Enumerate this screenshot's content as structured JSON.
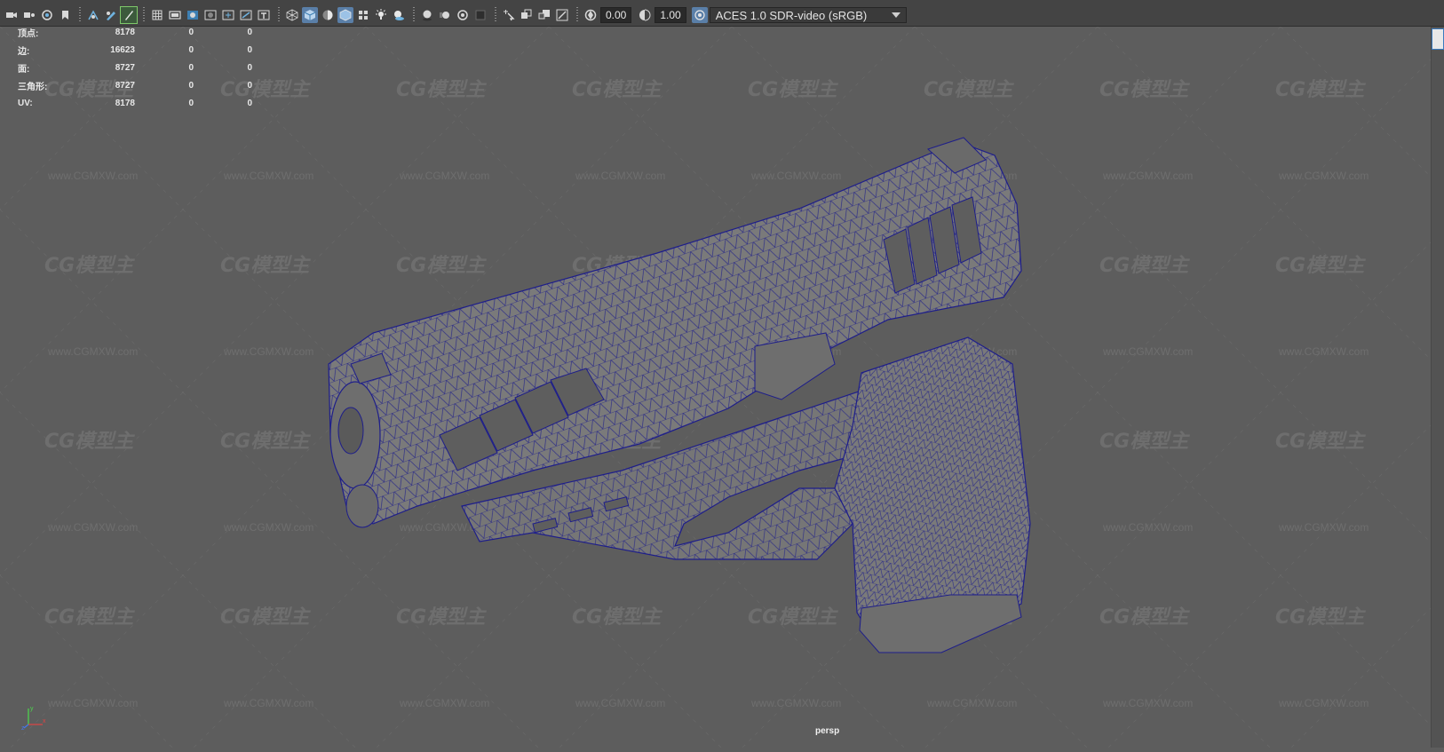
{
  "toolbar": {
    "icons": [
      "camera-icon",
      "camera-attributes-icon",
      "bookmark-icon",
      "image-plane-icon",
      "2d-pan-zoom-icon",
      "grease-pencil-icon",
      "grid-icon",
      "film-gate-icon",
      "resolution-gate-icon",
      "gate-mask-icon",
      "field-chart-icon",
      "safe-action-icon",
      "safe-title-icon",
      "wireframe-icon",
      "smooth-shade-icon",
      "default-material-icon",
      "wireframe-on-shaded-icon",
      "textured-icon",
      "use-lights-icon",
      "shadows-icon",
      "ambient-occlusion-icon",
      "motion-blur-icon",
      "anti-aliasing-icon",
      "depth-of-field-icon",
      "isolate-select-icon",
      "x-ray-icon",
      "x-ray-joints-icon",
      "backface-icon",
      "exposure-icon",
      "gamma-icon",
      "color-management-icon"
    ],
    "exposure_value": "0.00",
    "gamma_value": "1.00",
    "view_transform": "ACES 1.0 SDR-video (sRGB)"
  },
  "hud": {
    "rows": [
      {
        "label": "顶点:",
        "values": [
          "8178",
          "0",
          "0"
        ]
      },
      {
        "label": "边:",
        "values": [
          "16623",
          "0",
          "0"
        ]
      },
      {
        "label": "面:",
        "values": [
          "8727",
          "0",
          "0"
        ]
      },
      {
        "label": "三角形:",
        "values": [
          "8727",
          "0",
          "0"
        ]
      },
      {
        "label": "UV:",
        "values": [
          "8178",
          "0",
          "0"
        ]
      }
    ]
  },
  "viewport": {
    "camera": "persp",
    "watermark_logo": "CG模型主",
    "watermark_url": "www.CGMXW.com",
    "background_color": "#5d5d5d",
    "wire_color": "#1e1e8a",
    "mesh_color": "#7a7a7a"
  },
  "axis": {
    "x": "x",
    "y": "y",
    "z": "z"
  }
}
